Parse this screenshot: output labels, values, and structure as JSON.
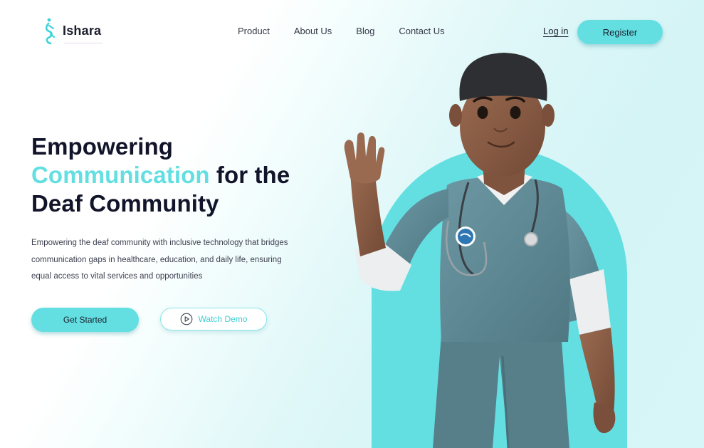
{
  "brand": {
    "name": "Ishara"
  },
  "nav": {
    "items": [
      {
        "label": "Product"
      },
      {
        "label": "About Us"
      },
      {
        "label": "Blog"
      },
      {
        "label": "Contact Us"
      }
    ],
    "login_label": "Log in",
    "register_label": "Register"
  },
  "hero": {
    "headline_line1": "Empowering",
    "headline_accent": "Communication",
    "headline_line2_rest": " for the",
    "headline_line3": "Deaf Community",
    "description_lines": [
      "Empowering the deaf community with inclusive technology that bridges",
      "communication gaps in healthcare, education, and daily life, ensuring",
      "equal access to vital services and opportunities"
    ],
    "primary_cta": "Get Started",
    "secondary_cta": "Watch Demo"
  },
  "icons": {
    "logo": "hand-sign-logo-icon",
    "play": "play-circle-icon"
  },
  "colors": {
    "accent": "#63dfe2",
    "text_dark": "#12152a",
    "scrubs": "#5e8a96",
    "skin": "#8b5e46"
  }
}
